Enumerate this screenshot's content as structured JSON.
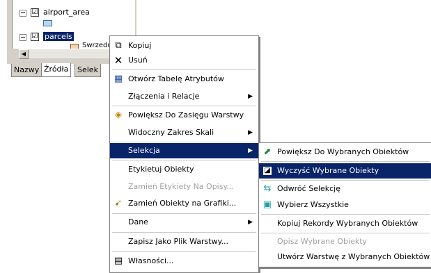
{
  "toc": {
    "layers": [
      {
        "label": "airport_area",
        "checked": "☑",
        "selected": false
      },
      {
        "label": "parcels",
        "checked": "☑",
        "selected": true
      }
    ],
    "clipped_label": "Swrzedu",
    "tabs": [
      "Nazwy",
      "Źródła",
      "Selek"
    ]
  },
  "context_menu": {
    "items": [
      {
        "label": "Kopiuj",
        "icon": "copy-icon"
      },
      {
        "label": "Usuń",
        "icon": "delete-icon"
      },
      {
        "label": "Otwórz Tabelę Atrybutów",
        "icon": "table-icon"
      },
      {
        "label": "Złączenia i Relacje",
        "submenu": true
      },
      {
        "label": "Powiększ Do Zasięgu Warstwy",
        "icon": "zoom-extent-icon"
      },
      {
        "label": "Widoczny Zakres Skali",
        "submenu": true
      },
      {
        "label": "Selekcja",
        "submenu": true,
        "highlighted": true
      },
      {
        "label": "Etykietuj Obiekty"
      },
      {
        "label": "Zamień Etykiety Na Opisy...",
        "disabled": true
      },
      {
        "label": "Zamień Obiekty na Grafiki...",
        "icon": "convert-graphics-icon"
      },
      {
        "label": "Dane",
        "submenu": true
      },
      {
        "label": "Zapisz Jako Plik Warstwy..."
      },
      {
        "label": "Własności...",
        "icon": "properties-icon"
      }
    ]
  },
  "selection_submenu": {
    "items": [
      {
        "label": "Powiększ Do Wybranych Obiektów",
        "icon": "zoom-selected-icon"
      },
      {
        "label": "Wyczyść Wybrane Obiekty",
        "icon": "clear-selection-icon",
        "highlighted": true
      },
      {
        "label": "Odwróć Selekcję",
        "icon": "switch-selection-icon"
      },
      {
        "label": "Wybierz Wszystkie",
        "icon": "select-all-icon"
      },
      {
        "label": "Kopiuj Rekordy Wybranych Obiektów"
      },
      {
        "label": "Opisz Wybrane Obiekty",
        "disabled": true
      },
      {
        "label": "Utwórz Warstwę z Wybranych Obiektów"
      }
    ]
  },
  "colors": {
    "highlight": "#0a246a",
    "menu_bg": "#ffffff",
    "panel_bg": "#d4d0c8"
  }
}
